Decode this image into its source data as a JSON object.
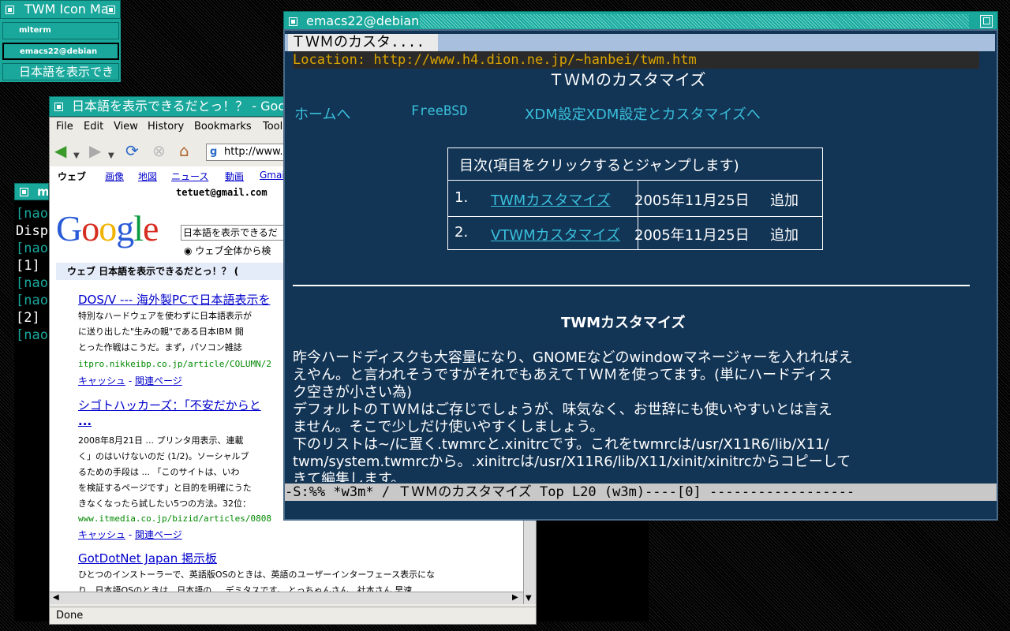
{
  "icon_manager": {
    "title": "TWM Icon Ma",
    "items": [
      "mlterm",
      "emacs22@debian",
      "日本語を表示でき"
    ]
  },
  "terminal": {
    "title": "m",
    "lines": [
      "[nao",
      "Disp",
      "[nao",
      "[1]",
      "[nao",
      "[nao",
      "[2]",
      "[nao"
    ]
  },
  "firefox": {
    "title": "日本語を表示できるだとっ！？ - Goo",
    "menu": [
      "File",
      "Edit",
      "View",
      "History",
      "Bookmarks",
      "Tool"
    ],
    "url": "http://www.g",
    "status": "Done",
    "google": {
      "tabs": [
        "ウェブ",
        "画像",
        "地図",
        "ニュース",
        "動画",
        "Gmai"
      ],
      "account": "tetuet@gmail.com",
      "logo": "Google",
      "search_value": "日本語を表示できるだ",
      "radio_label": "ウェブ全体から検",
      "results_bar": "ウェブ    日本語を表示できるだとっ！？  (",
      "results": [
        {
          "title": "DOS/V --- 海外製PCで日本語表示を",
          "lines": [
            "特別なハードウェアを使わずに日本語表示が",
            "に送り出した\"生みの親\"である日本IBM 開",
            "とった作戦はこうだ。まず，パソコン雑誌"
          ],
          "url": "itpro.nikkeibp.co.jp/article/COLUMN/2",
          "links": [
            "キャッシュ",
            "関連ページ"
          ]
        },
        {
          "title": "シゴトハッカーズ：「不安だからと",
          "title2": "...",
          "lines": [
            "2008年8月21日 ... プリンタ用表示、連載",
            "く」のはいけないのだ (1/2)。ソーシャルブ",
            "るための手段は ... 「このサイトは、いわ",
            "を検証するページです」と目的を明確にうた",
            "きなくなったら試したい5つの方法。32位："
          ],
          "url": "www.itmedia.co.jp/bizid/articles/0808",
          "links": [
            "キャッシュ",
            "関連ページ"
          ]
        },
        {
          "title": "GotDotNet Japan 掲示板",
          "lines": [
            "ひとつのインストーラーで、英語版OSのときは、英語のユーザーインターフェース表示にな",
            "り、日本語OSのときは、日本語の ... デミタスです。 とっちゃんさん、社本さん 早速"
          ]
        }
      ]
    }
  },
  "emacs": {
    "title": "emacs22@debian",
    "tab": "ＴＷＭのカスタ....",
    "location": "Location: http://www.h4.dion.ne.jp/~hanbei/twm.htm",
    "heading": "ＴＷＭのカスタマイズ",
    "nav": [
      "ホームへ",
      "FreeBSD",
      "XDM設定XDM設定とカスタマイズへ"
    ],
    "toc_header": "目次(項目をクリックするとジャンプします)",
    "toc": [
      {
        "num": "1.",
        "link": "TWMカスタマイズ",
        "date": "2005年11月25日",
        "action": "追加"
      },
      {
        "num": "2.",
        "link": "VTWMカスタマイズ",
        "date": "2005年11月25日",
        "action": "追加"
      }
    ],
    "section_title": "TWMカスタマイズ",
    "body": [
      "  昨今ハードディスクも大容量になり、GNOMEなどのwindowマネージャーを入れればえ",
      "えやん。と言われそうですがそれでもあえてＴＷＭを使ってます。(単にハードディス",
      "ク空きが小さい為)",
      "  デフォルトのＴＷＭはご存じでしょうが、味気なく、お世辞にも使いやすいとは言え",
      "ません。そこで少しだけ使いやすくしましょう。",
      "  下のリストは~/に置く.twmrcと.xinitrcです。これをtwmrcは/usr/X11R6/lib/X11/",
      "twm/system.twmrcから。.xinitrcは/usr/X11R6/lib/X11/xinit/xinitrcからコピーして",
      "きて編集します。"
    ],
    "modeline": "-S:%%  *w3m*  / ＴＷＭのカスタマイズ   Top L20   (w3m)----[0] ------------------"
  },
  "colors": {
    "title_bar": "#1aa89c",
    "emacs_bg": "#123455",
    "link": "#39c0dc",
    "location": "#d9a400"
  }
}
